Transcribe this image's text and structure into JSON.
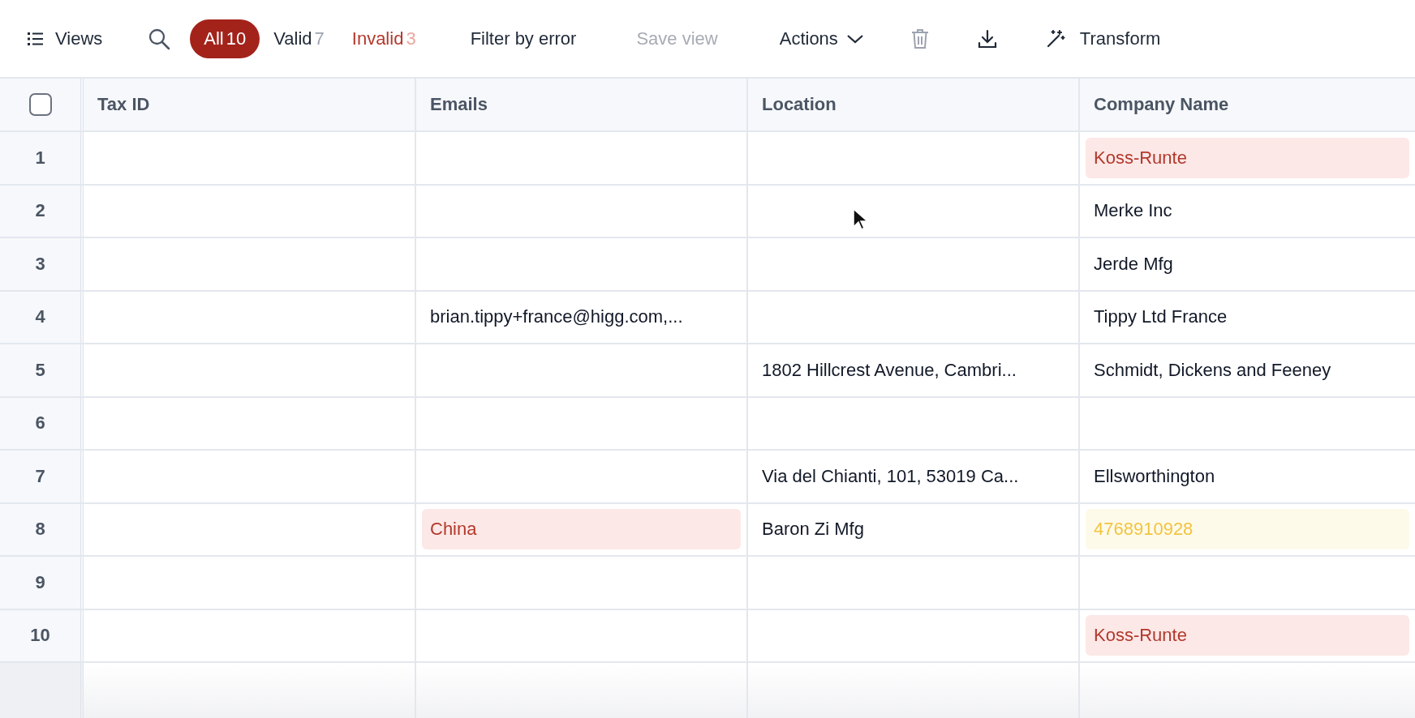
{
  "toolbar": {
    "views": "Views",
    "filters": [
      {
        "label": "All",
        "count": "10",
        "kind": "all",
        "selected": true
      },
      {
        "label": "Valid",
        "count": "7",
        "kind": "valid",
        "selected": false
      },
      {
        "label": "Invalid",
        "count": "3",
        "kind": "invalid",
        "selected": false
      }
    ],
    "filter_by_error": "Filter by error",
    "save_view": {
      "label": "Save view",
      "disabled": true
    },
    "actions": "Actions",
    "transform": "Transform"
  },
  "table": {
    "select_all": {
      "checked": false
    },
    "columns": [
      "Tax ID",
      "Emails",
      "Location",
      "Company Name"
    ],
    "rows": [
      {
        "number": "1",
        "cells": [
          null,
          null,
          null,
          {
            "text": "Koss-Runte",
            "kind": "error"
          }
        ]
      },
      {
        "number": "2",
        "cells": [
          null,
          null,
          null,
          {
            "text": "Merke Inc",
            "kind": "plain"
          }
        ]
      },
      {
        "number": "3",
        "cells": [
          null,
          null,
          null,
          {
            "text": "Jerde Mfg",
            "kind": "plain"
          }
        ]
      },
      {
        "number": "4",
        "cells": [
          null,
          {
            "text": "brian.tippy+france@higg.com,...",
            "kind": "plain"
          },
          null,
          {
            "text": "Tippy Ltd France",
            "kind": "plain"
          }
        ]
      },
      {
        "number": "5",
        "cells": [
          null,
          null,
          {
            "text": "1802 Hillcrest Avenue, Cambri...",
            "kind": "plain"
          },
          {
            "text": "Schmidt, Dickens and Feeney",
            "kind": "plain"
          }
        ]
      },
      {
        "number": "6",
        "cells": [
          null,
          null,
          null,
          null
        ]
      },
      {
        "number": "7",
        "cells": [
          null,
          null,
          {
            "text": "Via del Chianti, 101, 53019 Ca...",
            "kind": "plain"
          },
          {
            "text": "Ellsworthington",
            "kind": "plain"
          }
        ]
      },
      {
        "number": "8",
        "cells": [
          null,
          {
            "text": "China",
            "kind": "error"
          },
          {
            "text": "Baron Zi Mfg",
            "kind": "plain"
          },
          {
            "text": "4768910928",
            "kind": "warning"
          }
        ]
      },
      {
        "number": "9",
        "cells": [
          null,
          null,
          null,
          null
        ]
      },
      {
        "number": "10",
        "cells": [
          null,
          null,
          null,
          {
            "text": "Koss-Runte",
            "kind": "error"
          }
        ]
      }
    ]
  }
}
